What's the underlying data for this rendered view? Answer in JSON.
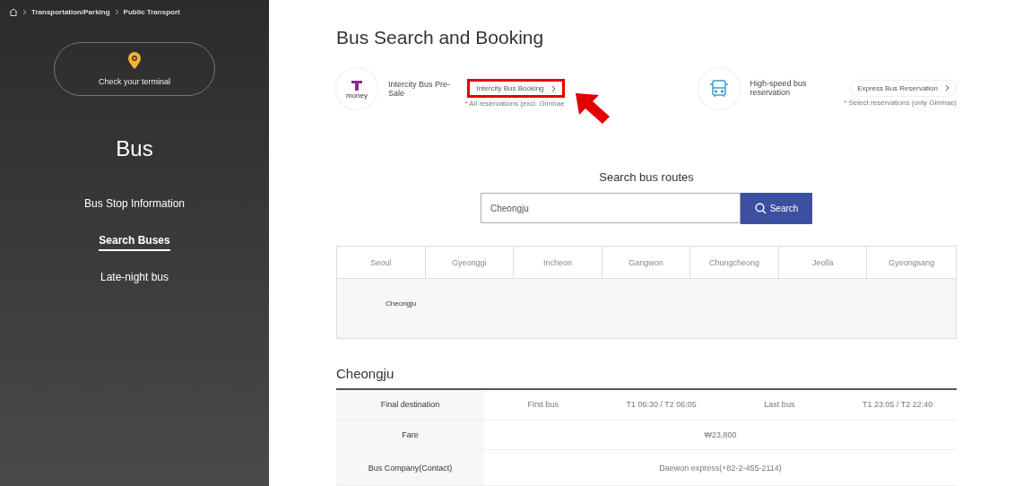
{
  "breadcrumb": [
    "Transportation/Parking",
    "Public Transport"
  ],
  "sidebar": {
    "terminal_button": "Check your terminal",
    "title": "Bus",
    "items": [
      {
        "label": "Bus Stop Information",
        "selected": false
      },
      {
        "label": "Search Buses",
        "selected": true
      },
      {
        "label": "Late-night bus",
        "selected": false
      }
    ]
  },
  "page_title": "Bus Search and Booking",
  "booking": [
    {
      "kind": "tmoney",
      "logo_text": "money",
      "label": "Intercity Bus Pre-Sale",
      "button": "Intercity Bus Booking",
      "note": "* All reservations (excl. Gimhae",
      "highlighted": true
    },
    {
      "kind": "bus",
      "label": "High-speed bus reservation",
      "button": "Express Bus Reservation",
      "note": "* Select reservations (only Gimhae)",
      "highlighted": false
    }
  ],
  "search": {
    "title": "Search bus routes",
    "value": "Cheongju",
    "button": "Search"
  },
  "regions": [
    "Seoul",
    "Gyeonggi",
    "Incheon",
    "Gangwon",
    "Chungcheong",
    "Jeolla",
    "Gyeongsang"
  ],
  "region_results": [
    "Cheongju"
  ],
  "detail": {
    "title": "Cheongju",
    "rows": [
      {
        "header": "Final destination",
        "cells": [
          "First bus",
          "T1 06:30 / T2 06:05",
          "Last bus",
          "T1 23:05 / T2 22:40"
        ]
      },
      {
        "header": "Fare",
        "cells": [
          "₩23,800"
        ]
      },
      {
        "header": "Bus Company(Contact)",
        "cells": [
          "Daewon express(+82-2-455-2114)"
        ]
      }
    ]
  }
}
